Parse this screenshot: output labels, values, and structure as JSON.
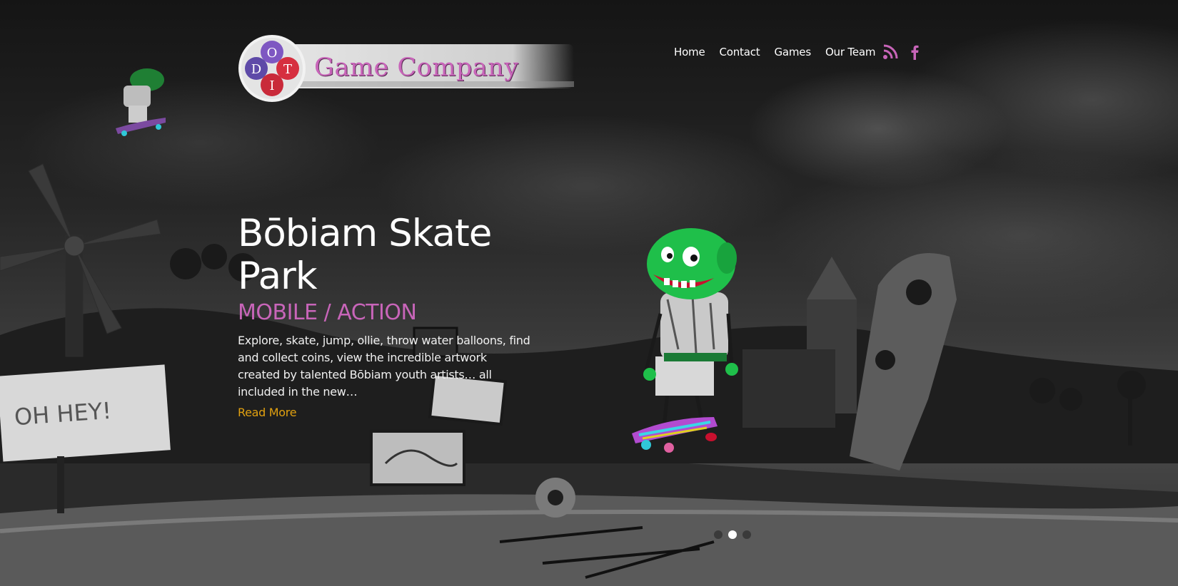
{
  "logo": {
    "badge_letters": [
      "D",
      "O",
      "I",
      "T"
    ],
    "company_name": "Game Company"
  },
  "nav": {
    "items": [
      {
        "label": "Home"
      },
      {
        "label": "Contact"
      },
      {
        "label": "Games"
      },
      {
        "label": "Our Team"
      }
    ]
  },
  "social": {
    "icons": [
      "rss-icon",
      "facebook-icon"
    ],
    "color": "#c865b9"
  },
  "slide": {
    "title": "Bōbiam Skate Park",
    "subtitle": "MOBILE / ACTION",
    "description": "Explore, skate, jump, ollie, throw water balloons, find and collect coins, view the incredible artwork created by talented Bōbiam youth artists… all included in the new…",
    "read_more": "Read More"
  },
  "scene": {
    "sign_text": "OH HEY!"
  },
  "slider": {
    "count": 3,
    "active_index": 1
  },
  "colors": {
    "accent_pink": "#c865b9",
    "read_more_orange": "#e0a010",
    "character_green": "#1fbf4a"
  }
}
